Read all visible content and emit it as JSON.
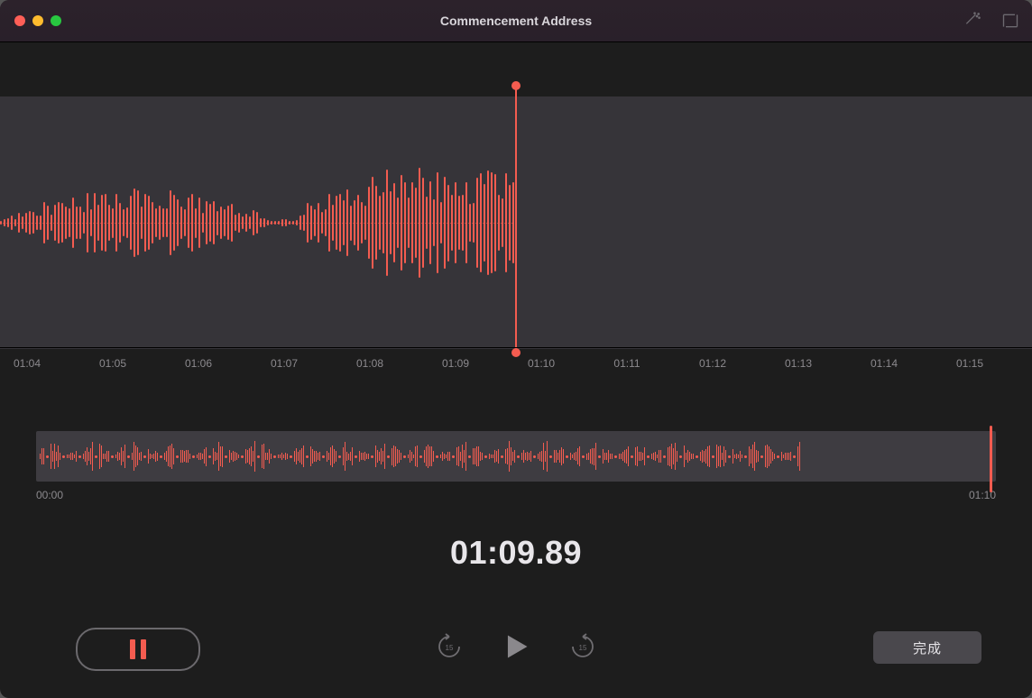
{
  "titlebar": {
    "title": "Commencement Address"
  },
  "ruler": {
    "ticks": [
      "01:04",
      "01:05",
      "01:06",
      "01:07",
      "01:08",
      "01:09",
      "01:10",
      "01:11",
      "01:12",
      "01:13",
      "01:14",
      "01:15"
    ]
  },
  "overview": {
    "start_label": "00:00",
    "end_label": "01:10"
  },
  "time_display": "01:09.89",
  "controls": {
    "done_label": "完成"
  },
  "colors": {
    "accent": "#f45c50"
  }
}
